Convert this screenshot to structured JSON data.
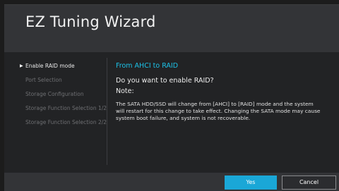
{
  "window": {
    "title": "EZ Tuning Wizard"
  },
  "steps": [
    {
      "label": "Enable RAID mode",
      "active": true
    },
    {
      "label": "Port Selection",
      "active": false
    },
    {
      "label": "Storage Configuration",
      "active": false
    },
    {
      "label": "Storage Function Selection 1/2",
      "active": false
    },
    {
      "label": "Storage Function Selection 2/2",
      "active": false
    }
  ],
  "content": {
    "subtitle": "From AHCI to RAID",
    "question": "Do you want to enable RAID?",
    "note_label": "Note:",
    "note_text": "The SATA HDD/SSD will change from [AHCI] to [RAID] mode and the system will restart for this change to take effect. Changing the SATA mode may cause system boot failure, and system is not recoverable."
  },
  "buttons": {
    "yes_label": "Yes",
    "cancel_label": "Cancel"
  },
  "colors": {
    "accent": "#1aa7d7",
    "subtitle": "#1cc2e8",
    "header_bg": "#333437",
    "panel_bg": "#222325"
  },
  "icons": {
    "step_marker": "play-arrow-icon"
  }
}
